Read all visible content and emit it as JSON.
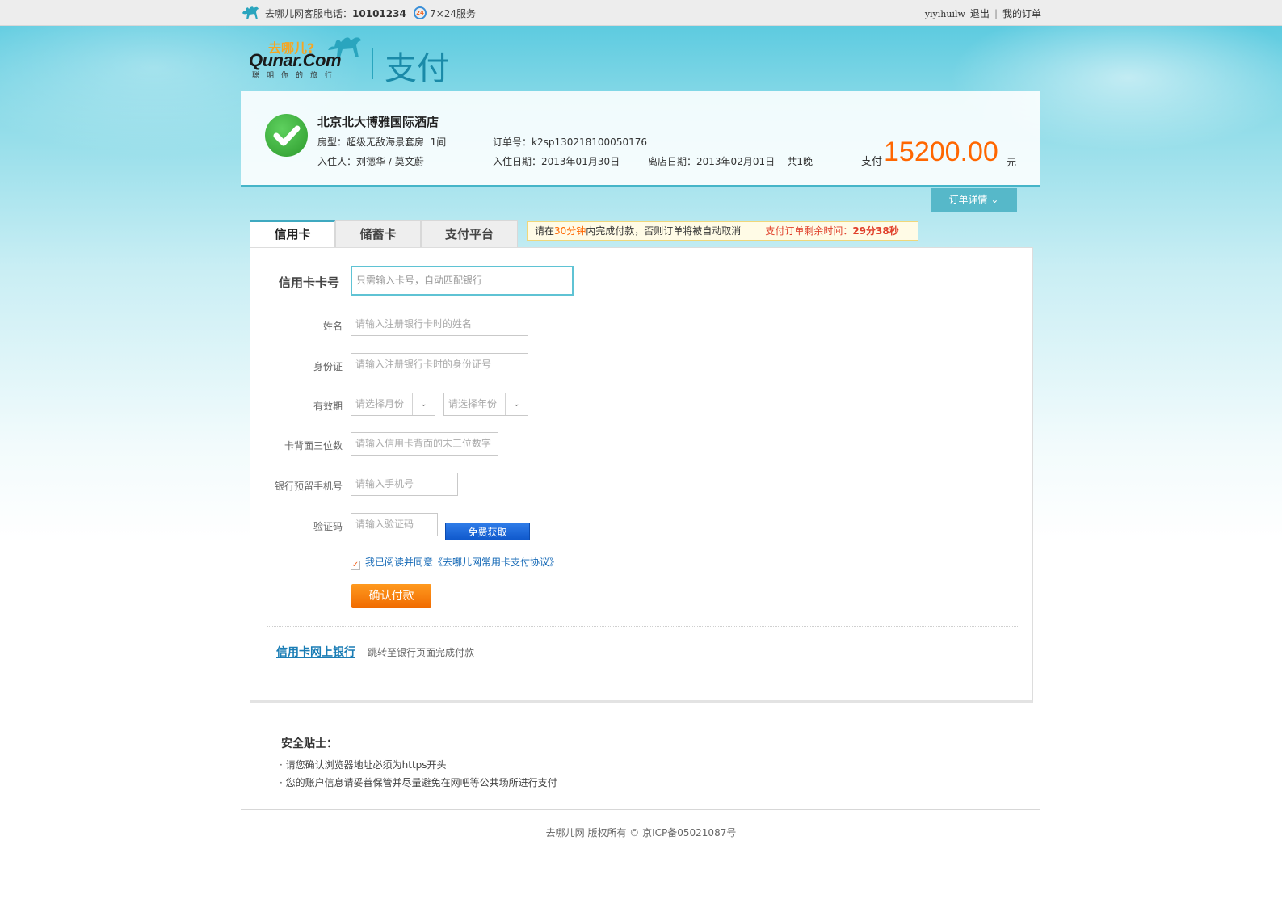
{
  "topbar": {
    "hotline_label": "去哪儿网客服电话：",
    "hotline_number": "10101234",
    "service_badge": "24",
    "service": "7×24服务",
    "username": "yiyihuilw",
    "logout": "退出",
    "my_orders": "我的订单"
  },
  "logo": {
    "brand_cn": "去哪儿?",
    "brand": "Qunar.Com",
    "slogan": "聪明你的旅行",
    "section": "支付"
  },
  "order": {
    "hotel": "北京北大博雅国际酒店",
    "room_label": "房型：",
    "room": "超级无敌海景套房",
    "room_count": "1间",
    "guest_label": "入住人：",
    "guests": "刘德华 / 莫文蔚",
    "order_no_label": "订单号：",
    "order_no": "k2sp130218100050176",
    "checkin_label": "入住日期：",
    "checkin": "2013年01月30日",
    "checkout_label": "离店日期：",
    "checkout": "2013年02月01日",
    "nights": "共1晚",
    "pay_label": "支付",
    "amount": "15200.00",
    "currency": "元",
    "detail_button": "订单详情"
  },
  "tabs": [
    "信用卡",
    "储蓄卡",
    "支付平台"
  ],
  "notice": {
    "prefix": "请在",
    "time": "30分钟",
    "suffix": "内完成付款，否则订单将被自动取消",
    "remain_label": "支付订单剩余时间：",
    "remain": "29分38秒"
  },
  "form": {
    "card_label": "信用卡卡号",
    "card_placeholder": "只需输入卡号，自动匹配银行",
    "name_label": "姓名",
    "name_placeholder": "请输入注册银行卡时的姓名",
    "id_label": "身份证",
    "id_placeholder": "请输入注册银行卡时的身份证号",
    "expiry_label": "有效期",
    "month_placeholder": "请选择月份",
    "year_placeholder": "请选择年份",
    "cvv_label": "卡背面三位数",
    "cvv_placeholder": "请输入信用卡背面的末三位数字",
    "phone_label": "银行预留手机号",
    "phone_placeholder": "请输入手机号",
    "code_label": "验证码",
    "code_placeholder": "请输入验证码",
    "sms_button": "免费获取",
    "agree_text": "我已阅读并同意《去哪儿网常用卡支付协议》",
    "agree_checked": true,
    "confirm_button": "确认付款",
    "netbank_link": "信用卡网上银行",
    "netbank_desc": "跳转至银行页面完成付款"
  },
  "tips": {
    "title": "安全贴士：",
    "items": [
      "· 请您确认浏览器地址必须为https开头",
      "· 您的账户信息请妥善保管并尽量避免在网吧等公共场所进行支付"
    ]
  },
  "footer": "去哪儿网 版权所有 © 京ICP备05021087号",
  "colors": {
    "accent": "#45b5c8",
    "amount": "#ff6600",
    "confirm": "#f58200",
    "link": "#1a7db5"
  }
}
